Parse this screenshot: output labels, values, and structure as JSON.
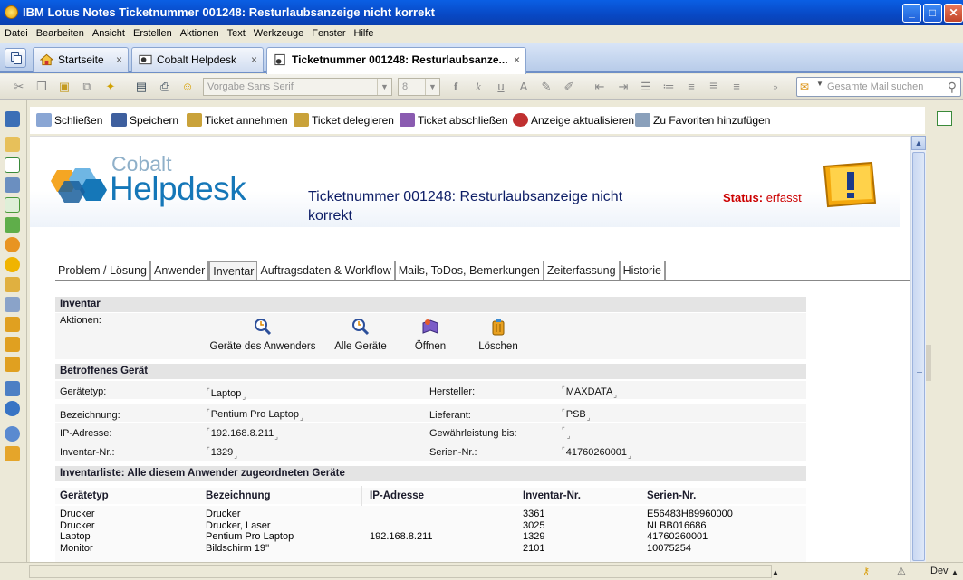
{
  "window": {
    "title": "IBM Lotus Notes Ticketnummer 001248: Resturlaubsanzeige nicht korrekt"
  },
  "menu": [
    "Datei",
    "Bearbeiten",
    "Ansicht",
    "Erstellen",
    "Aktionen",
    "Text",
    "Werkzeuge",
    "Fenster",
    "Hilfe"
  ],
  "tabs": [
    {
      "label": "Startseite",
      "close": "×"
    },
    {
      "label": "Cobalt Helpdesk",
      "close": "×"
    },
    {
      "label": "Ticketnummer 001248: Resturlaubsanze...",
      "close": "×"
    }
  ],
  "toolbar": {
    "font_name": "Vorgabe Sans Serif",
    "font_size": "8",
    "search_placeholder": "Gesamte Mail suchen"
  },
  "actions": [
    "Schließen",
    "Speichern",
    "Ticket annehmen",
    "Ticket delegieren",
    "Ticket abschließen",
    "Anzeige aktualisieren",
    "Zu Favoriten hinzufügen"
  ],
  "logo": {
    "line1": "Cobalt",
    "line2": "Helpdesk"
  },
  "ticket": {
    "title": "Ticketnummer 001248: Resturlaubsanzeige nicht korrekt",
    "status_label": "Status:",
    "status_value": "erfasst"
  },
  "form_tabs": [
    "Problem / Lösung",
    "Anwender",
    "Inventar",
    "Auftragsdaten & Workflow",
    "Mails, ToDos, Bemerkungen",
    "Zeiterfassung",
    "Historie"
  ],
  "inventar": {
    "section_title": "Inventar",
    "actions_label": "Aktionen:",
    "buttons": [
      "Geräte des Anwenders",
      "Alle Geräte",
      "Öffnen",
      "Löschen"
    ]
  },
  "device": {
    "section_title": "Betroffenes Gerät",
    "fields": [
      {
        "label": "Gerätetyp:",
        "value": "Laptop"
      },
      {
        "label": "Bezeichnung:",
        "value": "Pentium Pro Laptop"
      },
      {
        "label": "IP-Adresse:",
        "value": "192.168.8.211"
      },
      {
        "label": "Inventar-Nr.:",
        "value": "1329"
      },
      {
        "label": "Hersteller:",
        "value": "MAXDATA"
      },
      {
        "label": "Lieferant:",
        "value": "PSB"
      },
      {
        "label": "Gewährleistung bis:",
        "value": ""
      },
      {
        "label": "Serien-Nr.:",
        "value": "41760260001"
      }
    ]
  },
  "list": {
    "section_title": "Inventarliste: Alle diesem Anwender zugeordneten Geräte",
    "headers": [
      "Gerätetyp",
      "Bezeichnung",
      "IP-Adresse",
      "Inventar-Nr.",
      "Serien-Nr."
    ],
    "rows": [
      [
        "Drucker",
        "Drucker",
        "",
        "3361",
        "E56483H89960000"
      ],
      [
        "Drucker",
        "Drucker, Laser",
        "",
        "3025",
        "NLBB016686"
      ],
      [
        "Laptop",
        "Pentium Pro Laptop",
        "192.168.8.211",
        "1329",
        "41760260001"
      ],
      [
        "Monitor",
        "Bildschirm 19''",
        "",
        "2101",
        "10075254"
      ]
    ]
  },
  "statusbar": {
    "user": "Dev"
  }
}
